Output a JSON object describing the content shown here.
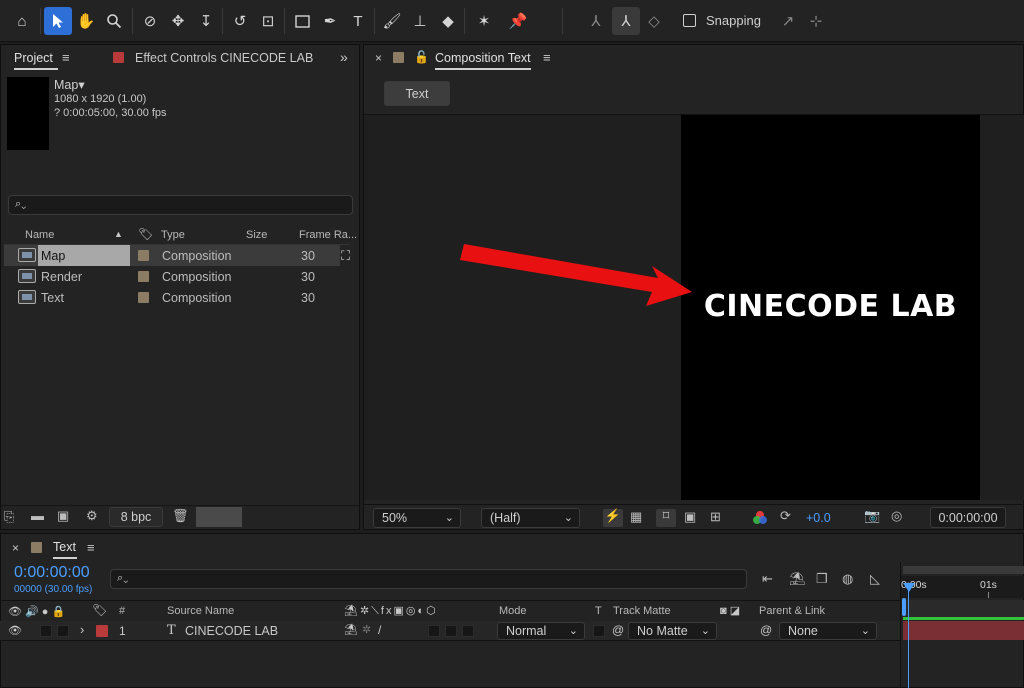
{
  "toolbar": {
    "snapping_label": "Snapping"
  },
  "project_panel": {
    "tab_label": "Project",
    "effect_controls_label": "Effect Controls CINECODE LAB",
    "selected_name": "Map▾",
    "dimensions": "1080 x 1920 (1.00)",
    "duration": "? 0:00:05:00, 30.00 fps",
    "search_placeholder": "",
    "columns": {
      "name": "Name",
      "type": "Type",
      "size": "Size",
      "frame_rate": "Frame Ra..."
    },
    "items": [
      {
        "name": "Map",
        "type": "Composition",
        "size": "",
        "frame_rate": "30"
      },
      {
        "name": "Render",
        "type": "Composition",
        "size": "",
        "frame_rate": "30"
      },
      {
        "name": "Text",
        "type": "Composition",
        "size": "",
        "frame_rate": "30"
      }
    ],
    "bpc_label": "8 bpc"
  },
  "composition_panel": {
    "tab_label": "Composition Text",
    "comp_button": "Text",
    "canvas_text": "CINECODE LAB",
    "zoom": "50%",
    "resolution": "(Half)",
    "exposure": "+0.0",
    "timecode": "0:00:00:00"
  },
  "timeline": {
    "tab_label": "Text",
    "current_time": "0:00:00:00",
    "frame_info": "00000 (30.00 fps)",
    "columns": {
      "number": "#",
      "source_name": "Source Name",
      "mode": "Mode",
      "t": "T",
      "track_matte": "Track Matte",
      "parent_link": "Parent & Link"
    },
    "layers": [
      {
        "number": "1",
        "type_glyph": "T",
        "name": "CINECODE LAB",
        "mode": "Normal",
        "track_matte": "No Matte",
        "parent": "None"
      }
    ],
    "ruler": {
      "start": "0:00s",
      "mark1": "01s"
    }
  },
  "colors": {
    "accent_blue": "#2d6fd6",
    "timecode_blue": "#4a9eff",
    "layer_label_red": "#b83a3a",
    "comp_label_tan": "#8c7c64",
    "annotation_arrow": "#e81010"
  }
}
